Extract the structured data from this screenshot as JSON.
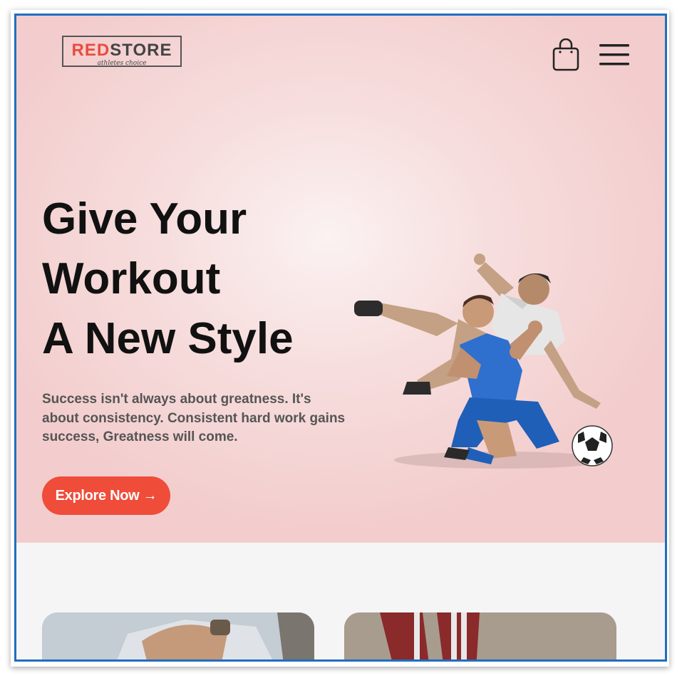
{
  "brand": {
    "logo_red": "RED",
    "logo_rest": "STORE",
    "logo_tagline": "athletes choice"
  },
  "header": {
    "cart_icon": "shopping-bag-icon",
    "menu_icon": "hamburger-menu-icon"
  },
  "hero": {
    "headline_lines": [
      "Give Your",
      "Workout",
      "A New Style"
    ],
    "subtext": "Success isn't always about greatness. It's about consistency. Consistent hard work gains success, Greatness will come.",
    "cta_label": "Explore Now →",
    "image_alt": "football players"
  },
  "colors": {
    "accent": "#ef4c3a",
    "hero_bg": "#f7dede",
    "frame_border": "#1f6fc0"
  }
}
